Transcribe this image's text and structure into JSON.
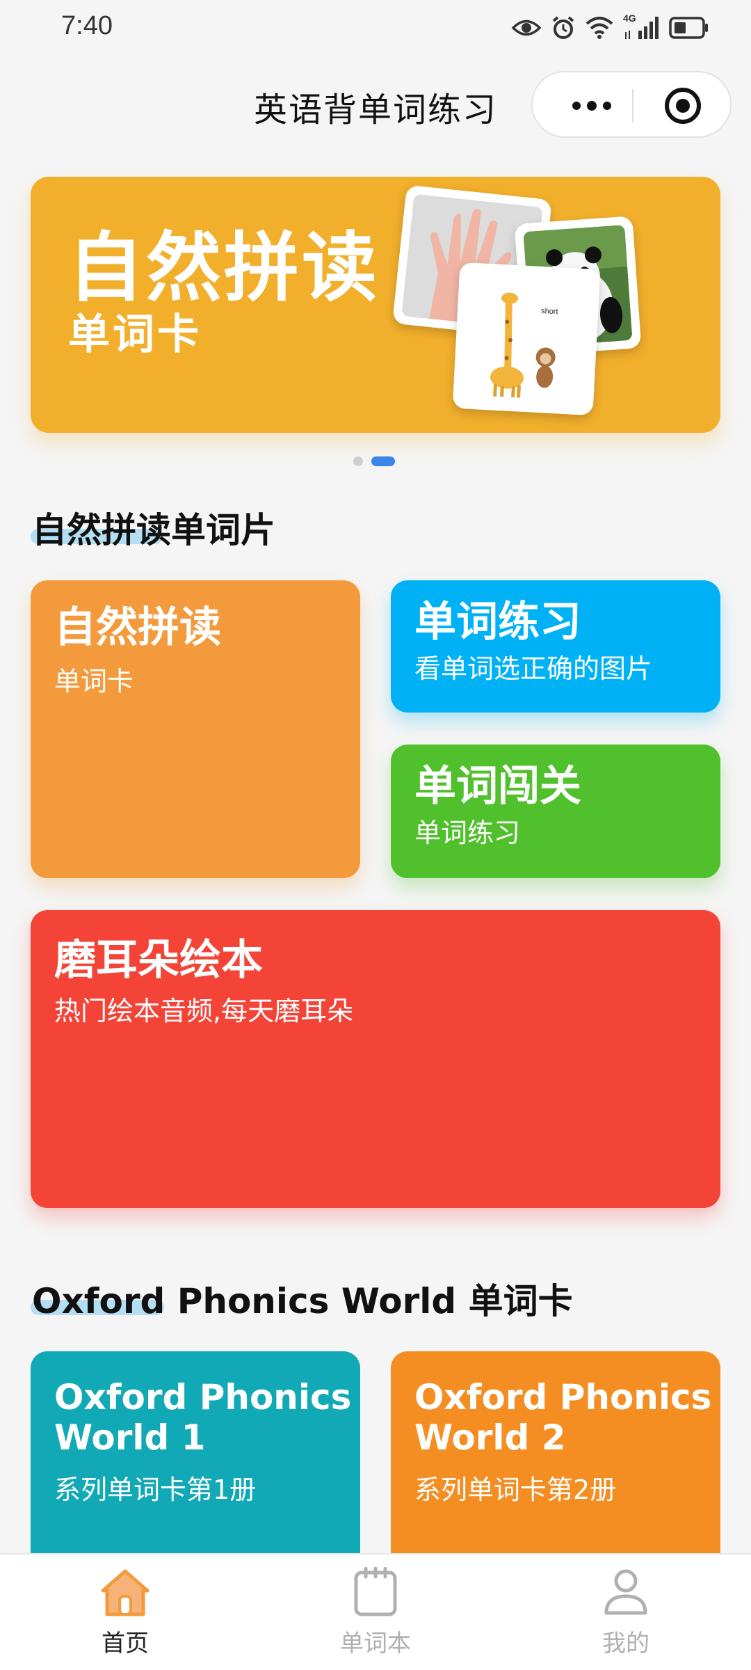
{
  "status_bar": {
    "time": "7:40",
    "network": "4G"
  },
  "header": {
    "title": "英语背单词练习"
  },
  "banner": {
    "title": "自然拼读",
    "subtitle": "单词卡",
    "photo_card_text": "short"
  },
  "sections": [
    {
      "title": "自然拼读单词片"
    },
    {
      "title": "Oxford Phonics World 单词卡"
    }
  ],
  "cards": {
    "phonics": {
      "title": "自然拼读",
      "subtitle": "单词卡",
      "color": "#f39a3c"
    },
    "practice": {
      "title": "单词练习",
      "subtitle": "看单词选正确的图片",
      "color": "#00b2f5"
    },
    "challenge": {
      "title": "单词闯关",
      "subtitle": "单词练习",
      "color": "#51c02d"
    },
    "picture_book": {
      "title": "磨耳朵绘本",
      "subtitle": "热门绘本音频,每天磨耳朵",
      "color": "#f44337"
    },
    "opw1": {
      "title_line1": "Oxford Phonics",
      "title_line2": "World 1",
      "subtitle": "系列单词卡第1册",
      "color": "#11a9b5"
    },
    "opw2": {
      "title_line1": "Oxford Phonics",
      "title_line2": "World 2",
      "subtitle": "系列单词卡第2册",
      "color": "#f58e22"
    }
  },
  "tabbar": {
    "items": [
      {
        "label": "首页",
        "icon": "home-icon",
        "active": true
      },
      {
        "label": "单词本",
        "icon": "notebook-icon",
        "active": false
      },
      {
        "label": "我的",
        "icon": "user-icon",
        "active": false
      }
    ],
    "active_color": "#f39a3c",
    "inactive_color": "#b0b0b0"
  }
}
